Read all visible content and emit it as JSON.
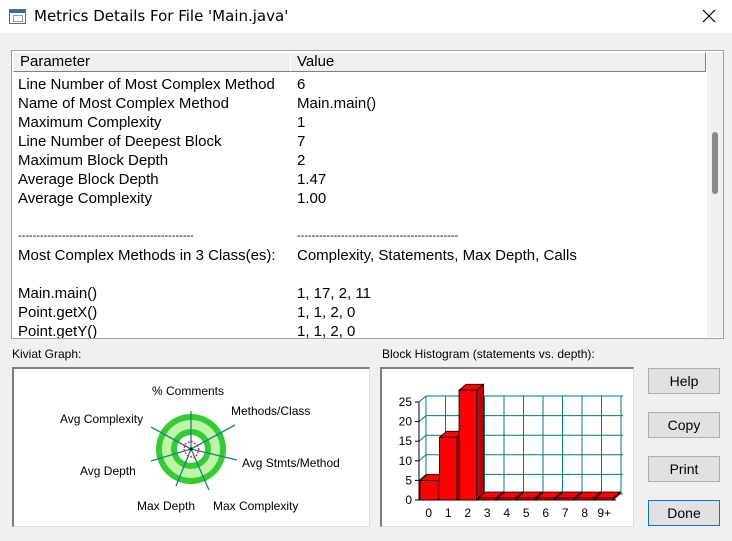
{
  "window": {
    "title": "Metrics Details For File 'Main.java'",
    "icon": "window-icon",
    "close_icon": "close-icon"
  },
  "table": {
    "columns": [
      "Parameter",
      "Value"
    ],
    "rows": [
      [
        "Line Number of Most Complex Method",
        "6"
      ],
      [
        "Name of Most Complex Method",
        "Main.main()"
      ],
      [
        "Maximum Complexity",
        "1"
      ],
      [
        "Line Number of Deepest Block",
        "7"
      ],
      [
        "Maximum Block Depth",
        "2"
      ],
      [
        "Average Block Depth",
        "1.47"
      ],
      [
        "Average Complexity",
        "1.00"
      ],
      [
        "",
        ""
      ],
      [
        "------------------------------------------------",
        "--------------------------------------------"
      ],
      [
        "Most Complex Methods in 3 Class(es):",
        "Complexity, Statements, Max Depth, Calls"
      ],
      [
        "",
        ""
      ],
      [
        "Main.main()",
        "1, 17, 2, 11"
      ],
      [
        "Point.getX()",
        "1, 1, 2, 0"
      ],
      [
        "Point.getY()",
        "1, 1, 2, 0"
      ]
    ]
  },
  "kiviat": {
    "label": "Kiviat Graph:",
    "axes": [
      "% Comments",
      "Methods/Class",
      "Avg Stmts/Method",
      "Max Complexity",
      "Max Depth",
      "Avg Depth",
      "Avg Complexity"
    ]
  },
  "histogram": {
    "label": "Block Histogram (statements vs. depth):",
    "bar_color": "#ff0000"
  },
  "buttons": {
    "help": "Help",
    "copy": "Copy",
    "print": "Print",
    "done": "Done"
  },
  "chart_data": {
    "type": "bar",
    "categories": [
      "0",
      "1",
      "2",
      "3",
      "4",
      "5",
      "6",
      "7",
      "8",
      "9+"
    ],
    "values": [
      5,
      16,
      28,
      0,
      0,
      0,
      0,
      0,
      0,
      0
    ],
    "ylim": [
      0,
      25
    ],
    "yticks": [
      "0",
      "5",
      "10",
      "15",
      "20",
      "25"
    ],
    "grid": true
  }
}
